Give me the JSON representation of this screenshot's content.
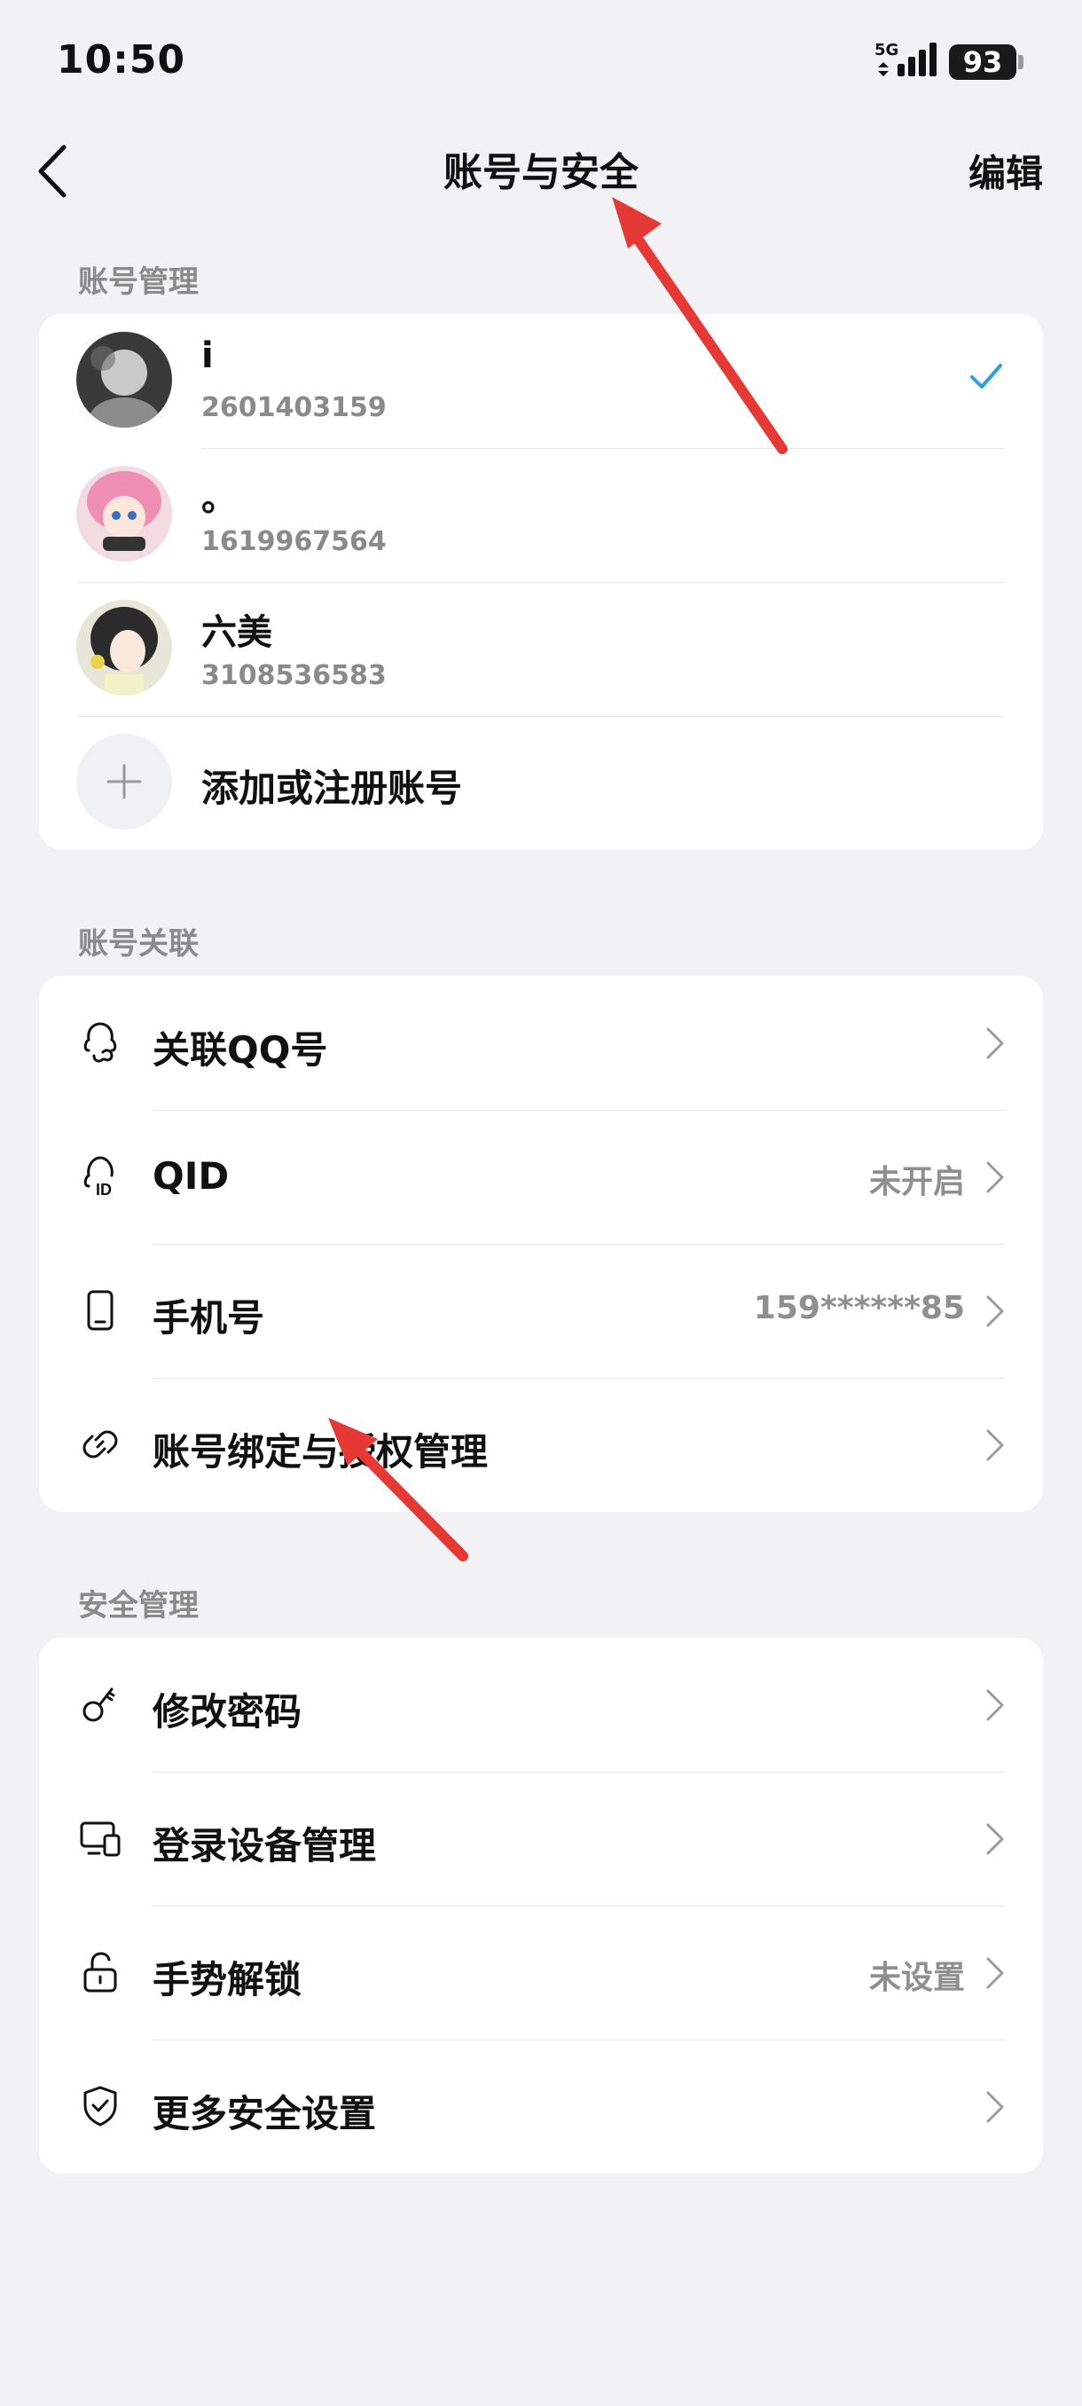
{
  "status_bar": {
    "time": "10:50",
    "network": "5G",
    "battery": "93"
  },
  "nav": {
    "title": "账号与安全",
    "edit_label": "编辑"
  },
  "account_management": {
    "section_title": "账号管理",
    "accounts": [
      {
        "name": "i",
        "id": "2601403159",
        "selected": true
      },
      {
        "name": "。",
        "id": "1619967564",
        "selected": false
      },
      {
        "name": "六美",
        "id": "3108536583",
        "selected": false
      }
    ],
    "add_label": "添加或注册账号"
  },
  "account_linking": {
    "section_title": "账号关联",
    "items": [
      {
        "label": "关联QQ号",
        "value": "",
        "icon": "qq-link-icon"
      },
      {
        "label": "QID",
        "value": "未开启",
        "icon": "qid-icon"
      },
      {
        "label": "手机号",
        "value": "159******85",
        "icon": "phone-icon"
      },
      {
        "label": "账号绑定与授权管理",
        "value": "",
        "icon": "link-icon"
      }
    ]
  },
  "security_management": {
    "section_title": "安全管理",
    "items": [
      {
        "label": "修改密码",
        "value": "",
        "icon": "key-icon"
      },
      {
        "label": "登录设备管理",
        "value": "",
        "icon": "devices-icon"
      },
      {
        "label": "手势解锁",
        "value": "未设置",
        "icon": "unlock-icon"
      },
      {
        "label": "更多安全设置",
        "value": "",
        "icon": "shield-check-icon"
      }
    ]
  },
  "colors": {
    "accent_check": "#2f9de4",
    "annotation_arrow": "#e53935",
    "background": "#f2f2f4"
  }
}
